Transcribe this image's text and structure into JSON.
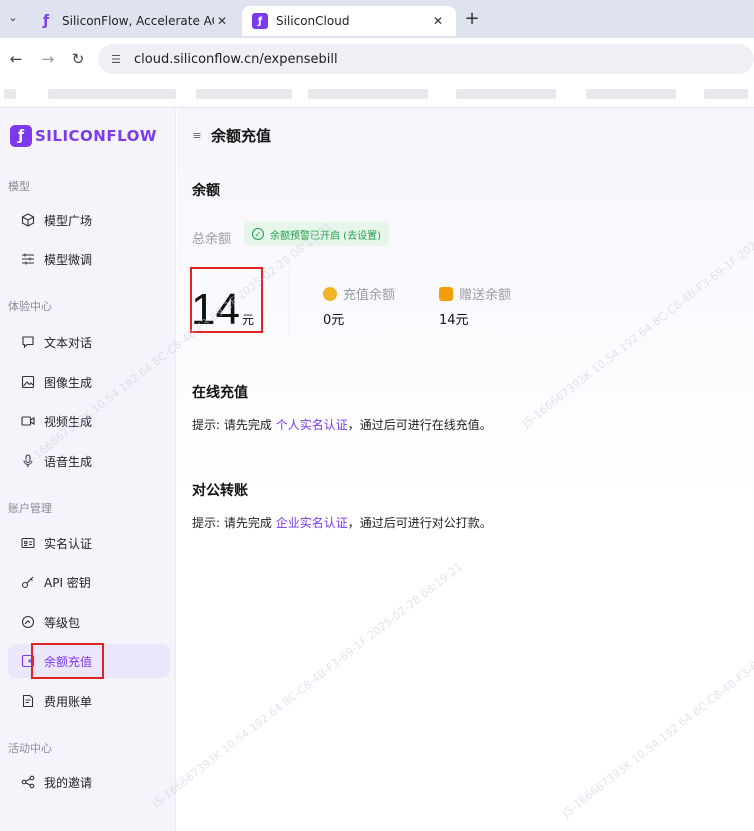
{
  "browser": {
    "tabs": [
      {
        "title": "SiliconFlow, Accelerate AGI fo",
        "active": false
      },
      {
        "title": "SiliconCloud",
        "active": true
      }
    ],
    "url": "cloud.siliconflow.cn/expensebill"
  },
  "sidebar": {
    "logo": "SILICONFLOW",
    "sections": [
      {
        "label": "模型",
        "items": [
          {
            "label": "模型广场",
            "icon": "cube-icon"
          },
          {
            "label": "模型微调",
            "icon": "sliders-icon"
          }
        ]
      },
      {
        "label": "体验中心",
        "items": [
          {
            "label": "文本对话",
            "icon": "chat-icon"
          },
          {
            "label": "图像生成",
            "icon": "image-icon"
          },
          {
            "label": "视频生成",
            "icon": "video-icon"
          },
          {
            "label": "语音生成",
            "icon": "microphone-icon"
          }
        ]
      },
      {
        "label": "账户管理",
        "items": [
          {
            "label": "实名认证",
            "icon": "id-card-icon"
          },
          {
            "label": "API 密钥",
            "icon": "key-icon"
          },
          {
            "label": "等级包",
            "icon": "gauge-icon"
          },
          {
            "label": "余额充值",
            "icon": "wallet-icon",
            "active": true
          },
          {
            "label": "费用账单",
            "icon": "bill-icon"
          }
        ]
      },
      {
        "label": "活动中心",
        "items": [
          {
            "label": "我的邀请",
            "icon": "share-icon"
          }
        ]
      }
    ]
  },
  "main": {
    "page_title": "余额充值",
    "balance": {
      "heading": "余额",
      "total_label": "总余额",
      "alert_badge": "余额预警已开启 (去设置)",
      "total_value": "14",
      "total_unit": "元",
      "recharge_label": "充值余额",
      "recharge_value": "0元",
      "gift_label": "赠送余额",
      "gift_value": "14元"
    },
    "online": {
      "heading": "在线充值",
      "hint_prefix": "提示: 请先完成",
      "hint_link": "个人实名认证",
      "hint_suffix": "，通过后可进行在线充值。"
    },
    "corporate": {
      "heading": "对公转账",
      "hint_prefix": "提示: 请先完成",
      "hint_link": "企业实名认证",
      "hint_suffix": "，通过后可进行对公打款。"
    }
  },
  "watermarks": [
    "JS-166667393K 10.54.192.64 8C-C8-4B-F3-69-1F 2025-02-28 08:19:21"
  ],
  "colors": {
    "accent": "#7c3aed",
    "success": "#1f9d49",
    "highlight": "#e02424"
  }
}
